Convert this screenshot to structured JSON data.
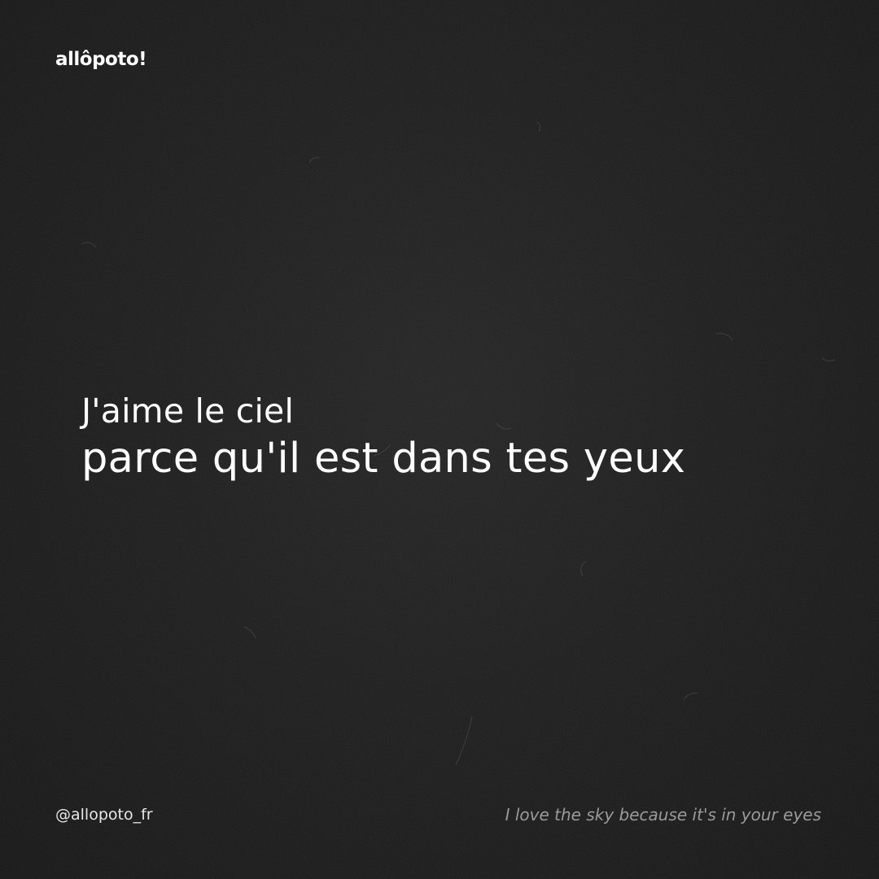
{
  "brand": {
    "logo_text": "allôpoto!"
  },
  "quote": {
    "line1": "J'aime le ciel",
    "line2": "parce qu'il est dans tes yeux"
  },
  "footer": {
    "handle": "@allopoto_fr",
    "translation": "I love the sky because it's in your eyes"
  },
  "colors": {
    "background": "#1b1b1b",
    "text_primary": "#ffffff",
    "text_secondary": "#9a9a9a"
  }
}
